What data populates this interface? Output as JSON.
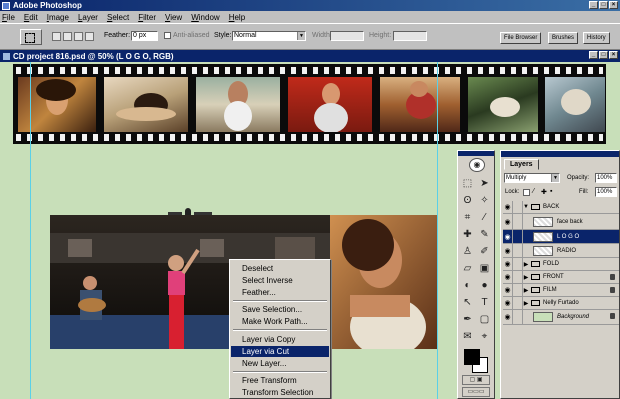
{
  "app": {
    "title": "Adobe Photoshop"
  },
  "menu": [
    "File",
    "Edit",
    "Image",
    "Layer",
    "Select",
    "Filter",
    "View",
    "Window",
    "Help"
  ],
  "options": {
    "feather_label": "Feather:",
    "feather_value": "0 px",
    "antialiased_label": "Anti-aliased",
    "style_label": "Style:",
    "style_value": "Normal",
    "width_label": "Width:",
    "height_label": "Height:",
    "palette_tabs": [
      "File Browser",
      "Brushes",
      "History"
    ]
  },
  "document": {
    "title": "CD project 816.psd @ 50% (L O G O, RGB)"
  },
  "context_menu": {
    "items": [
      "Deselect",
      "Select Inverse",
      "Feather...",
      "Save Selection...",
      "Make Work Path...",
      "Layer via Copy",
      "Layer via Cut",
      "New Layer...",
      "Free Transform",
      "Transform Selection"
    ],
    "highlighted": "Layer via Cut"
  },
  "layers_panel": {
    "tab": "Layers",
    "blend_mode": "Multiply",
    "opacity_label": "Opacity:",
    "opacity_value": "100%",
    "lock_label": "Lock:",
    "fill_label": "Fill:",
    "fill_value": "100%",
    "layers": [
      {
        "name": "BACK",
        "type": "set"
      },
      {
        "name": "face back",
        "type": "layer"
      },
      {
        "name": "L O G O",
        "type": "layer",
        "selected": true
      },
      {
        "name": "RADIO",
        "type": "layer"
      },
      {
        "name": "FOLD",
        "type": "set"
      },
      {
        "name": "FRONT",
        "type": "set"
      },
      {
        "name": "FILM",
        "type": "set"
      },
      {
        "name": "Nelly Furtado",
        "type": "set"
      },
      {
        "name": "Background",
        "type": "background"
      }
    ]
  },
  "colors": {
    "accent": "#0a246a",
    "canvas": "#c8dfb9"
  }
}
